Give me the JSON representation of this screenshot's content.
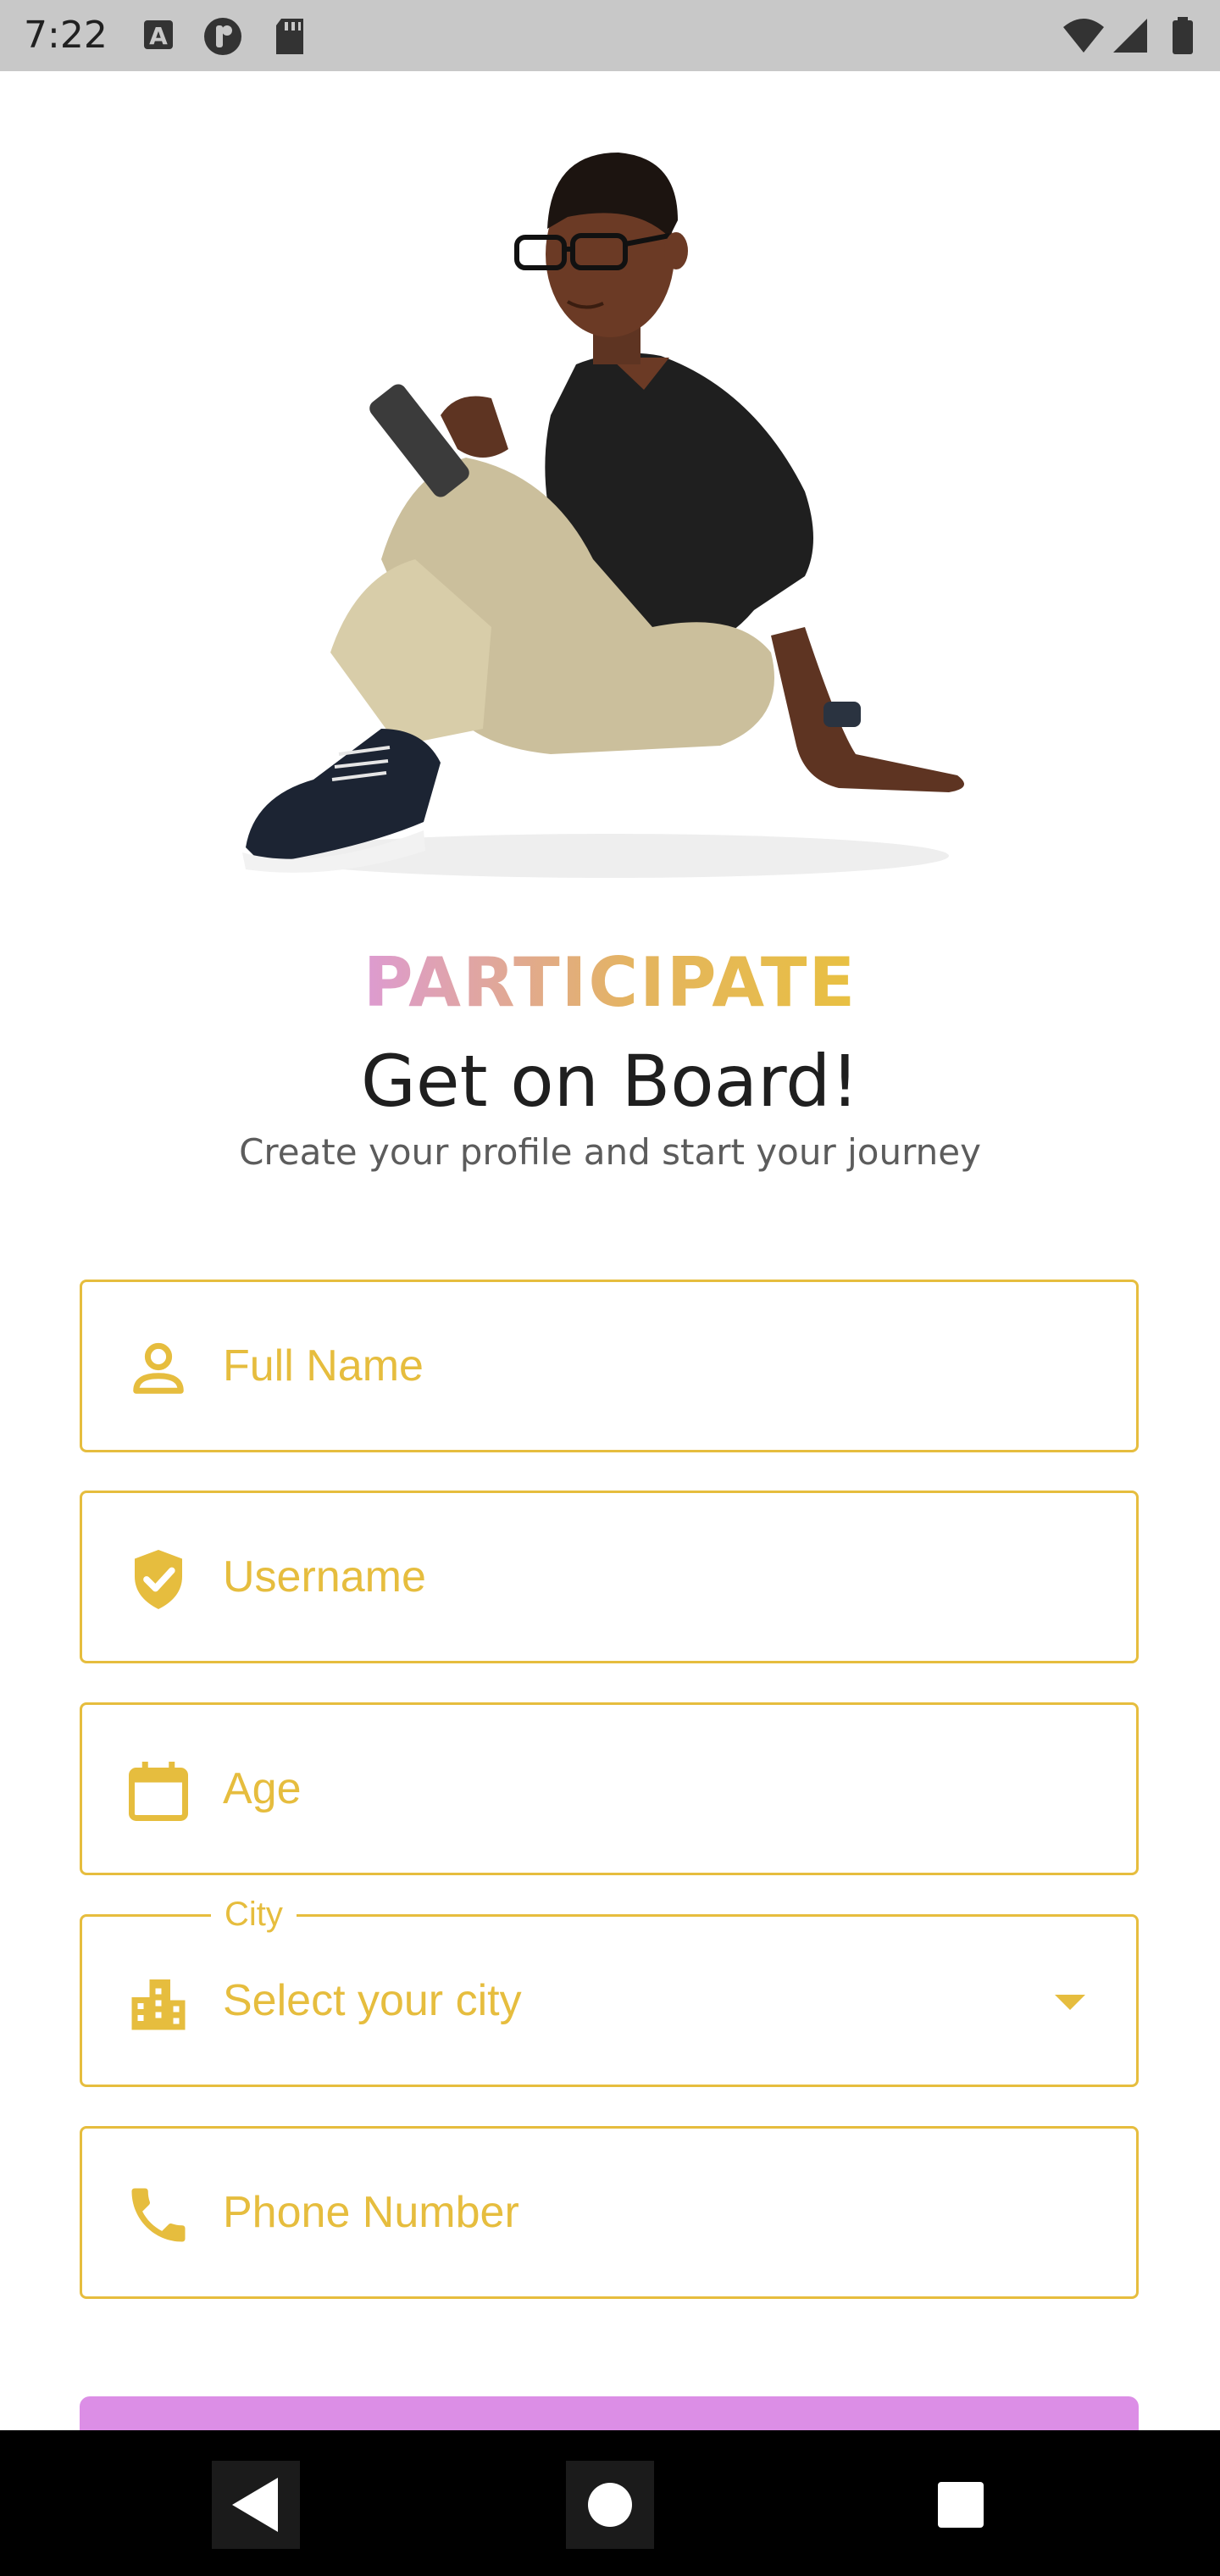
{
  "status_bar": {
    "time": "7:22",
    "left_icons": [
      "a-icon",
      "podcast-icon",
      "sd-card-icon"
    ],
    "right_icons": [
      "wifi-icon",
      "signal-icon",
      "battery-icon"
    ]
  },
  "hero": {
    "illustration": "person-sitting-with-phone"
  },
  "header": {
    "eyebrow": "PARTICIPATE",
    "title": "Get on Board!",
    "subtitle": "Create your profile and start your journey"
  },
  "form": {
    "full_name": {
      "placeholder": "Full Name",
      "icon": "person-icon"
    },
    "username": {
      "placeholder": "Username",
      "icon": "verified-shield-icon"
    },
    "age": {
      "placeholder": "Age",
      "icon": "calendar-icon"
    },
    "city": {
      "label": "City",
      "value": "Select your city",
      "icon": "city-icon"
    },
    "phone": {
      "placeholder": "Phone Number",
      "icon": "phone-icon"
    }
  },
  "colors": {
    "accent_gold": "#e6bd3e",
    "accent_pink": "#dc8ee6",
    "text_dark": "#1f1f1f",
    "text_muted": "#5c5c5c"
  },
  "nav_bar": {
    "buttons": [
      "back-icon",
      "home-icon",
      "recents-icon"
    ]
  }
}
